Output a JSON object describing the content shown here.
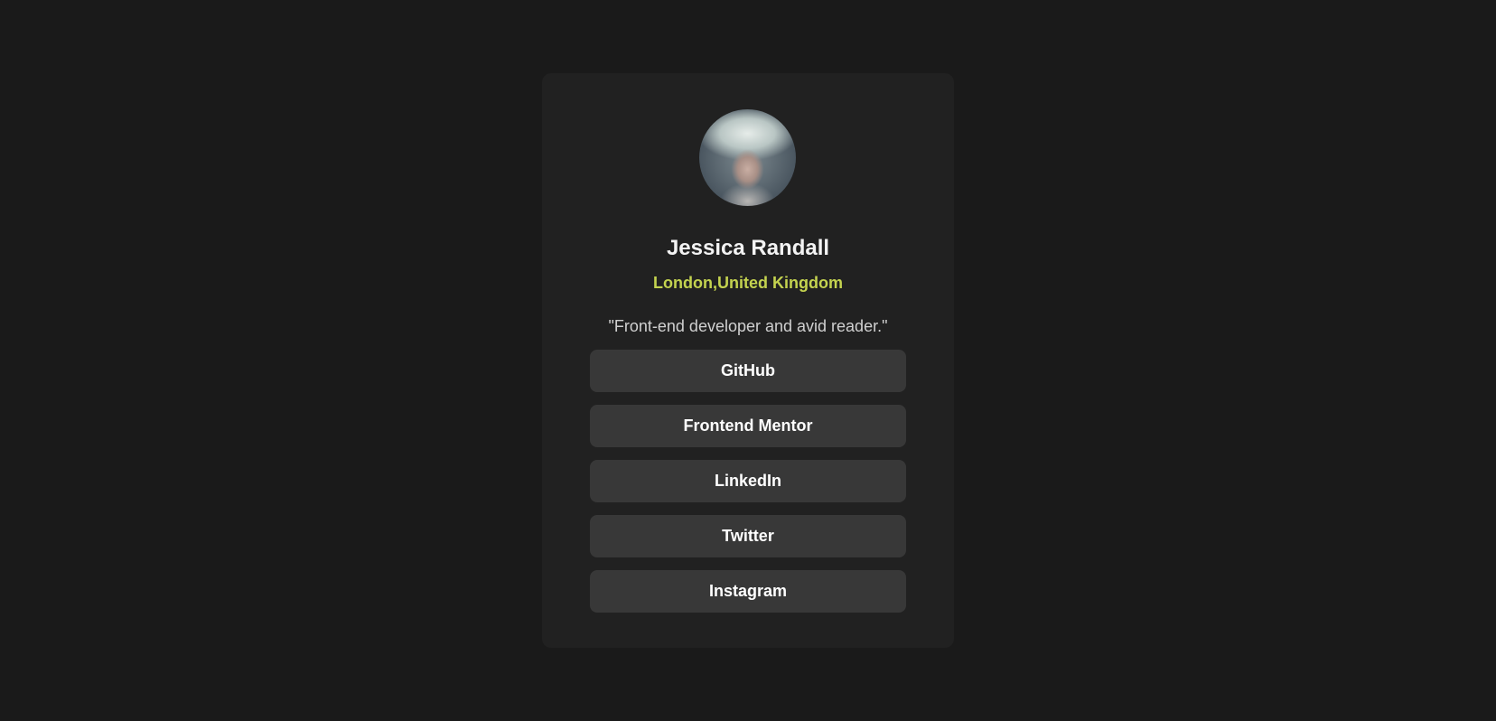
{
  "profile": {
    "name": "Jessica Randall",
    "location": "London,United Kingdom",
    "bio": "\"Front-end developer and avid reader.\"",
    "avatar_icon": "profile-photo"
  },
  "links": [
    {
      "label": "GitHub"
    },
    {
      "label": "Frontend Mentor"
    },
    {
      "label": "LinkedIn"
    },
    {
      "label": "Twitter"
    },
    {
      "label": "Instagram"
    }
  ],
  "colors": {
    "background": "#1a1a1a",
    "card": "#212121",
    "button": "#383838",
    "accent": "#c4d34f"
  }
}
